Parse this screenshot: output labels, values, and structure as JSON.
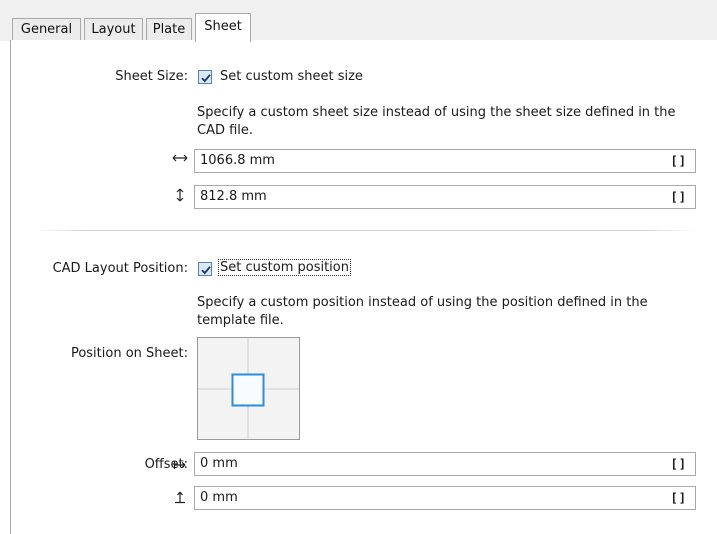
{
  "tabs": [
    {
      "label": "General"
    },
    {
      "label": "Layout"
    },
    {
      "label": "Plate"
    },
    {
      "label": "Sheet"
    }
  ],
  "sheet_size": {
    "label": "Sheet Size:",
    "checkbox_label": "Set custom sheet size",
    "checked": true,
    "description": "Specify a custom sheet size instead of using the sheet size defined in the CAD file.",
    "width_value": "1066.8 mm",
    "height_value": "812.8 mm",
    "width_icon": "horizontal-arrows-icon",
    "height_icon": "vertical-arrows-icon",
    "unit_button": "[]"
  },
  "cad_layout": {
    "label": "CAD Layout Position:",
    "checkbox_label": "Set custom position",
    "checked": true,
    "description": "Specify a custom position instead of using the position defined in the template file.",
    "position_label": "Position on Sheet:",
    "offset_label": "Offset:",
    "offset_x_value": "0 mm",
    "offset_y_value": "0 mm",
    "offset_x_icon": "offset-horizontal-icon",
    "offset_y_icon": "offset-vertical-icon",
    "unit_button": "[]"
  },
  "colors": {
    "accent": "#2b8de0",
    "checkbox_fill": "#dbe8f8",
    "border": "#a9a9a9"
  }
}
